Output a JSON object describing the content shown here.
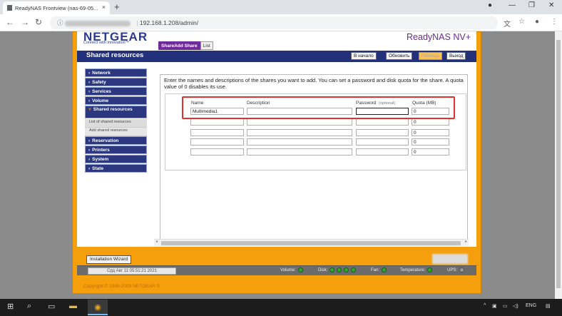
{
  "browser": {
    "tab_title": "ReadyNAS Frontview (nas-69-05...",
    "tab_close": "×",
    "new_tab": "+",
    "url": "192.168.1.208/admin/",
    "window_controls": [
      "—",
      "❐",
      "✕"
    ]
  },
  "brand": {
    "logo": "NETGEAR",
    "tagline": "Connect with Innovation™",
    "product": "ReadyNAS NV+"
  },
  "page_tabs": [
    {
      "label": "ShareAdd Share",
      "active": true
    },
    {
      "label": "List",
      "active": false
    }
  ],
  "header": {
    "title": "Shared resources",
    "buttons": [
      {
        "label": "В начало"
      },
      {
        "label": "Обновить"
      },
      {
        "label": "Помощь"
      },
      {
        "label": "Выход"
      }
    ]
  },
  "sidebar": {
    "items": [
      {
        "label": "Network"
      },
      {
        "label": "Safety"
      },
      {
        "label": "Services"
      },
      {
        "label": "Volume"
      },
      {
        "label": "Shared resources"
      },
      {
        "label": "Reservation"
      },
      {
        "label": "Printers"
      },
      {
        "label": "System"
      },
      {
        "label": "State"
      }
    ],
    "subitems": [
      {
        "label": "List of shared resources"
      },
      {
        "label": "Add shared resources"
      }
    ]
  },
  "main": {
    "intro": "Enter the names and descriptions of the shares you want to add.  You can set a password and disk quota for the share. A quota value of 0 disables its use.",
    "columns": {
      "name": "Name",
      "description": "Description",
      "password": "Password",
      "password_hint": "(optional)",
      "quota": "Quota (MB)"
    },
    "rows": [
      {
        "name": "Multimedia1",
        "description": "",
        "password": "",
        "quota": "0"
      },
      {
        "name": "",
        "description": "",
        "password": "",
        "quota": "0"
      },
      {
        "name": "",
        "description": "",
        "password": "",
        "quota": "0"
      },
      {
        "name": "",
        "description": "",
        "password": "",
        "quota": "0"
      },
      {
        "name": "",
        "description": "",
        "password": "",
        "quota": "0"
      }
    ]
  },
  "footer": {
    "wizard_button": "Installation Wizard",
    "datetime": "Срд Авг 11  05:51:21 2021",
    "status": {
      "volume": "Volume:",
      "disk": "Disk:",
      "fan": "Fan:",
      "temperature": "Temperature:",
      "ups": "UPS:"
    },
    "copyright": "Copyright © 1996-2009 NETGEAR ®"
  },
  "taskbar": {
    "language": "ENG"
  },
  "colors": {
    "frame_orange": "#f59f0d",
    "navy": "#23307a",
    "purple": "#6d2b9a",
    "highlight_red": "#e0322f"
  }
}
